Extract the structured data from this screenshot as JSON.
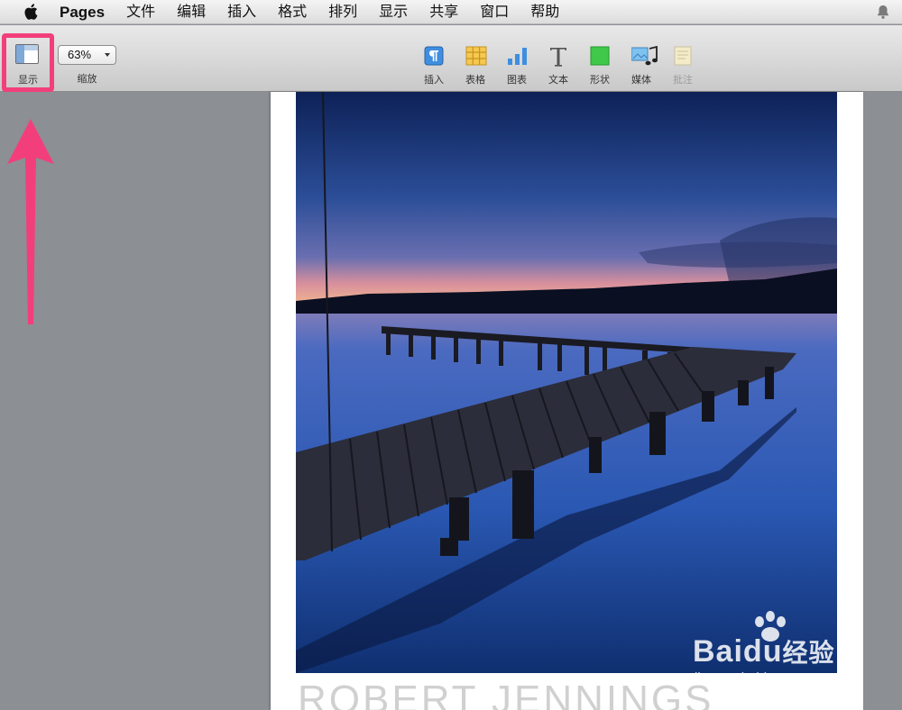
{
  "menubar": {
    "app_name": "Pages",
    "items": [
      "文件",
      "编辑",
      "插入",
      "格式",
      "排列",
      "显示",
      "共享",
      "窗口",
      "帮助"
    ]
  },
  "toolbar": {
    "view_label": "显示",
    "zoom_value": "63%",
    "zoom_label": "缩放",
    "tools": [
      {
        "label": "插入",
        "icon": "insert-paragraph-icon",
        "enabled": true
      },
      {
        "label": "表格",
        "icon": "table-icon",
        "enabled": true
      },
      {
        "label": "图表",
        "icon": "chart-icon",
        "enabled": true
      },
      {
        "label": "文本",
        "icon": "text-icon",
        "enabled": true
      },
      {
        "label": "形状",
        "icon": "shape-icon",
        "enabled": true
      },
      {
        "label": "媒体",
        "icon": "media-icon",
        "enabled": true
      },
      {
        "label": "批注",
        "icon": "comment-icon",
        "enabled": false
      }
    ]
  },
  "document": {
    "title_text": "ROBERT JENNINGS"
  },
  "watermark": {
    "brand": "Bai",
    "brand2": "du",
    "brand3": "经验",
    "url": "jingyan.baidu.com"
  },
  "colors": {
    "highlight": "#f23f7c",
    "sky_top": "#0f2a6e",
    "water": "#2c56a4"
  }
}
